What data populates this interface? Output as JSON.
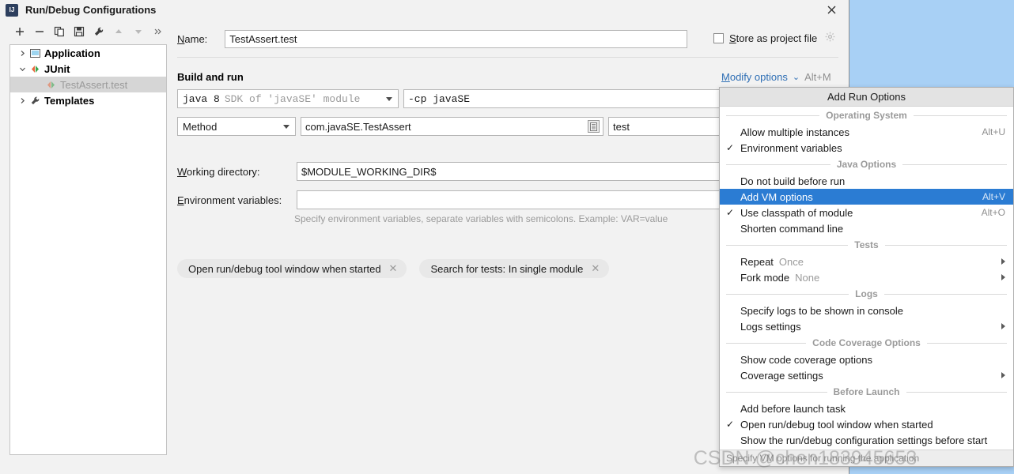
{
  "window": {
    "title": "Run/Debug Configurations",
    "app_icon": "intellij-idea-icon",
    "close_icon": "close-icon"
  },
  "toolbar": {
    "buttons": [
      {
        "name": "add-configuration-button",
        "icon": "plus-icon"
      },
      {
        "name": "remove-configuration-button",
        "icon": "minus-icon"
      },
      {
        "name": "copy-configuration-button",
        "icon": "copy-icon"
      },
      {
        "name": "save-configuration-button",
        "icon": "save-icon"
      },
      {
        "name": "edit-templates-button",
        "icon": "wrench-icon"
      },
      {
        "name": "move-up-button",
        "icon": "arrow-up-icon"
      },
      {
        "name": "move-down-button",
        "icon": "arrow-down-icon"
      },
      {
        "name": "more-button",
        "icon": "chevron-double-right-icon"
      }
    ]
  },
  "tree": {
    "items": [
      {
        "label": "Application",
        "icon": "application-icon",
        "expanded": false,
        "selected": false,
        "child": false
      },
      {
        "label": "JUnit",
        "icon": "junit-icon",
        "expanded": true,
        "selected": false,
        "child": false
      },
      {
        "label": "TestAssert.test",
        "icon": "junit-icon",
        "expanded": null,
        "selected": true,
        "child": true
      },
      {
        "label": "Templates",
        "icon": "wrench-icon",
        "expanded": false,
        "selected": false,
        "child": false
      }
    ]
  },
  "form": {
    "name_label": "Name:",
    "name_label_mnemonic": "N",
    "name_value": "TestAssert.test",
    "store_as_project_file_label": "Store as project file",
    "store_as_project_file_mnemonic": "S",
    "store_as_project_file_checked": false,
    "store_gear_icon": "gear-icon",
    "section_title": "Build and run",
    "modify_options_label": "Modify options",
    "modify_options_mnemonic": "M",
    "modify_options_shortcut": "Alt+M",
    "sdk_value_strong": "java 8",
    "sdk_value_dim": "SDK of 'javaSE' module",
    "cp_value": "-cp javaSE",
    "kind_value": "Method",
    "class_value": "com.javaSE.TestAssert",
    "class_badge_icon": "class-chooser-icon",
    "method_value": "test",
    "working_directory_label": "Working directory:",
    "working_directory_mnemonic": "W",
    "working_directory_value": "$MODULE_WORKING_DIR$",
    "environment_variables_label": "Environment variables:",
    "environment_variables_mnemonic": "E",
    "environment_variables_value": "",
    "environment_hint": "Specify environment variables, separate variables with semicolons. Example: VAR=value",
    "chips": [
      {
        "label": "Open run/debug tool window when started",
        "close_icon": "close-small-icon"
      },
      {
        "label": "Search for tests: In single module",
        "close_icon": "close-small-icon"
      }
    ]
  },
  "menu": {
    "title": "Add Run Options",
    "status_text": "Specify VM options for running the application",
    "groups": [
      {
        "header": "Operating System",
        "items": [
          {
            "label": "Allow multiple instances",
            "checked": false,
            "accel": "Alt+U",
            "submenu": false,
            "highlighted": false,
            "value": ""
          },
          {
            "label": "Environment variables",
            "checked": true,
            "accel": "",
            "submenu": false,
            "highlighted": false,
            "value": ""
          }
        ]
      },
      {
        "header": "Java Options",
        "items": [
          {
            "label": "Do not build before run",
            "checked": false,
            "accel": "",
            "submenu": false,
            "highlighted": false,
            "value": ""
          },
          {
            "label": "Add VM options",
            "checked": false,
            "accel": "Alt+V",
            "submenu": false,
            "highlighted": true,
            "value": ""
          },
          {
            "label": "Use classpath of module",
            "checked": true,
            "accel": "Alt+O",
            "submenu": false,
            "highlighted": false,
            "value": ""
          },
          {
            "label": "Shorten command line",
            "checked": false,
            "accel": "",
            "submenu": false,
            "highlighted": false,
            "value": ""
          }
        ]
      },
      {
        "header": "Tests",
        "items": [
          {
            "label": "Repeat",
            "checked": false,
            "accel": "",
            "submenu": true,
            "highlighted": false,
            "value": "Once"
          },
          {
            "label": "Fork mode",
            "checked": false,
            "accel": "",
            "submenu": true,
            "highlighted": false,
            "value": "None"
          }
        ]
      },
      {
        "header": "Logs",
        "items": [
          {
            "label": "Specify logs to be shown in console",
            "checked": false,
            "accel": "",
            "submenu": false,
            "highlighted": false,
            "value": ""
          },
          {
            "label": "Logs settings",
            "checked": false,
            "accel": "",
            "submenu": true,
            "highlighted": false,
            "value": ""
          }
        ]
      },
      {
        "header": "Code Coverage Options",
        "items": [
          {
            "label": "Show code coverage options",
            "checked": false,
            "accel": "",
            "submenu": false,
            "highlighted": false,
            "value": ""
          },
          {
            "label": "Coverage settings",
            "checked": false,
            "accel": "",
            "submenu": true,
            "highlighted": false,
            "value": ""
          }
        ]
      },
      {
        "header": "Before Launch",
        "items": [
          {
            "label": "Add before launch task",
            "checked": false,
            "accel": "",
            "submenu": false,
            "highlighted": false,
            "value": ""
          },
          {
            "label": "Open run/debug tool window when started",
            "checked": true,
            "accel": "",
            "submenu": false,
            "highlighted": false,
            "value": ""
          },
          {
            "label": "Show the run/debug configuration settings before start",
            "checked": false,
            "accel": "",
            "submenu": false,
            "highlighted": false,
            "value": ""
          }
        ]
      }
    ]
  },
  "watermark": {
    "text": "CSDN @chen183945653"
  },
  "colors": {
    "accent": "#2b7cd3",
    "link": "#2f6fb5",
    "dialog_bg": "#f2f2f2",
    "desktop_bg": "#a8d0f5",
    "selection_bg": "#d6d6d6"
  }
}
